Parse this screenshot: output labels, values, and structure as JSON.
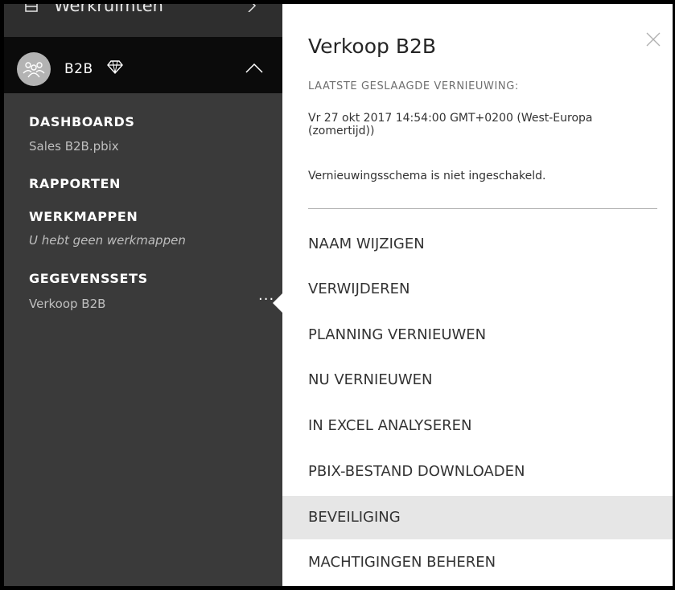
{
  "sidebar": {
    "workspaces_label": "Werkruimten",
    "group": {
      "name": "B2B",
      "premium_icon": "diamond-icon"
    },
    "sections": [
      {
        "title": "DASHBOARDS",
        "items": [
          "Sales B2B.pbix"
        ]
      },
      {
        "title": "RAPPORTEN",
        "items": []
      },
      {
        "title": "WERKMAPPEN",
        "empty_text": "U hebt geen werkmappen"
      },
      {
        "title": "GEGEVENSSETS",
        "items": [
          "Verkoop B2B"
        ]
      }
    ],
    "ellipsis": "..."
  },
  "panel": {
    "title": "Verkoop B2B",
    "last_refresh_label": "LAATSTE GESLAAGDE VERNIEUWING:",
    "last_refresh_value": "Vr 27 okt 2017 14:54:00 GMT+0200 (West-Europa (zomertijd))",
    "schedule_text": "Vernieuwingsschema is niet ingeschakeld.",
    "menu": [
      "NAAM WIJZIGEN",
      "VERWIJDEREN",
      "PLANNING VERNIEUWEN",
      "NU VERNIEUWEN",
      "IN EXCEL ANALYSEREN",
      "PBIX-BESTAND DOWNLOADEN",
      "BEVEILIGING",
      "MACHTIGINGEN BEHEREN"
    ],
    "active_item": "BEVEILIGING"
  },
  "colors": {
    "sidebar_bg": "#3a3a3a",
    "group_bg": "#0b0b0b",
    "panel_bg": "#ffffff",
    "hover_bg": "#e6e6e6"
  }
}
